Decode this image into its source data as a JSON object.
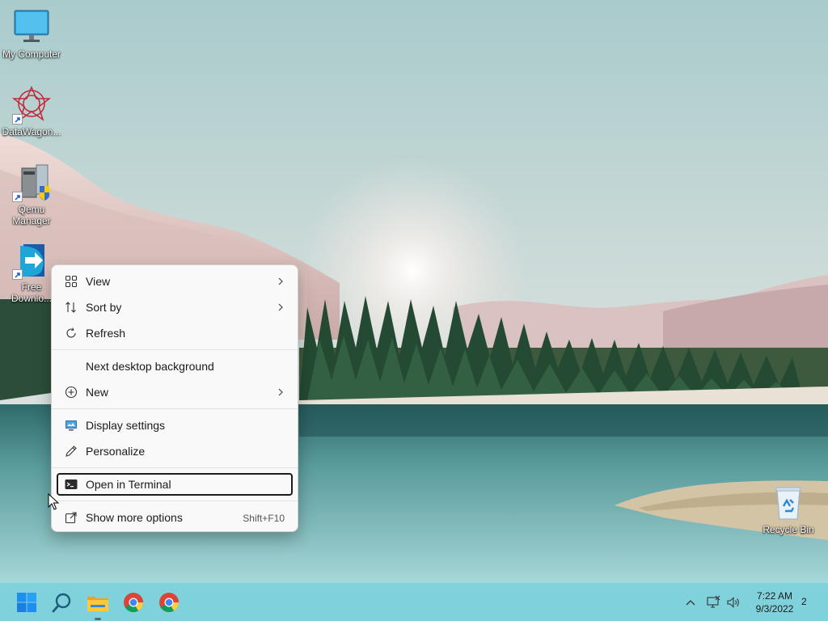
{
  "desktop": {
    "icons": [
      {
        "label": "My Computer"
      },
      {
        "label": "DataWagon..."
      },
      {
        "label_line1": "Qemu",
        "label_line2": "Manager"
      },
      {
        "label_line1": "Free",
        "label_line2": "Downlo..."
      },
      {
        "label": "Recycle Bin"
      }
    ]
  },
  "context_menu": {
    "items": [
      {
        "label": "View",
        "icon": "grid-icon"
      },
      {
        "label": "Sort by",
        "icon": "sort-icon"
      },
      {
        "label": "Refresh",
        "icon": "refresh-icon"
      },
      {
        "label": "Next desktop background"
      },
      {
        "label": "New",
        "icon": "plus-circle-icon"
      },
      {
        "label": "Display settings",
        "icon": "display-icon"
      },
      {
        "label": "Personalize",
        "icon": "pen-icon"
      },
      {
        "label": "Open in Terminal",
        "icon": "terminal-icon"
      },
      {
        "label": "Show more options",
        "icon": "share-icon",
        "shortcut": "Shift+F10"
      }
    ]
  },
  "taskbar": {
    "clock_time": "7:22 AM",
    "clock_date": "9/3/2022",
    "notification_count": "2",
    "apps": [
      "start",
      "search",
      "file-explorer",
      "chrome",
      "chrome"
    ]
  },
  "colors": {
    "taskbar": "#7fd1dc",
    "menu_bg": "#f9f9f9",
    "focus_border": "#1c1c1c"
  }
}
